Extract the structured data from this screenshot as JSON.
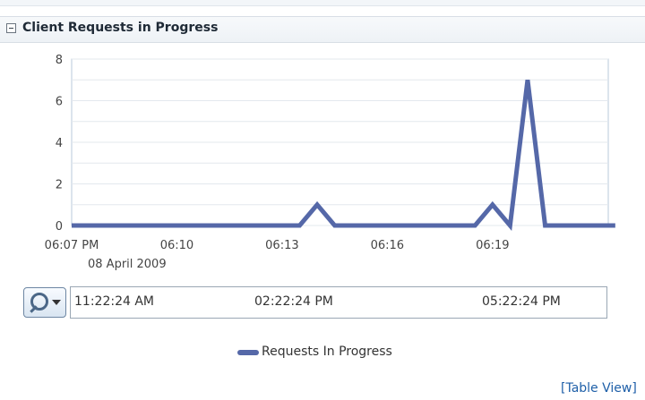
{
  "panel": {
    "title": "Client Requests in Progress"
  },
  "chart_data": {
    "type": "line",
    "title": "",
    "xlabel": "",
    "ylabel": "",
    "ylim": [
      0,
      8
    ],
    "y_ticks": [
      "0",
      "2",
      "4",
      "6",
      "8"
    ],
    "x_tick_labels": [
      "06:07 PM",
      "06:10",
      "06:13",
      "06:16",
      "06:19"
    ],
    "x_sub_label": "08 April 2009",
    "grid": true,
    "series": [
      {
        "name": "Requests In Progress",
        "color": "#5568a8",
        "x": [
          "06:07",
          "06:07.5",
          "06:08",
          "06:08.5",
          "06:09",
          "06:09.5",
          "06:10",
          "06:10.5",
          "06:11",
          "06:11.5",
          "06:12",
          "06:12.5",
          "06:13",
          "06:13.5",
          "06:14",
          "06:14.5",
          "06:15",
          "06:15.5",
          "06:16",
          "06:16.5",
          "06:17",
          "06:17.5",
          "06:18",
          "06:18.5",
          "06:19",
          "06:19.5",
          "06:20",
          "06:20.5",
          "06:21",
          "06:21.5",
          "06:22",
          "06:22.5"
        ],
        "values": [
          0,
          0,
          0,
          0,
          0,
          0,
          0,
          0,
          0,
          0,
          0,
          0,
          0,
          0,
          1,
          0,
          0,
          0,
          0,
          0,
          0,
          0,
          0,
          0,
          1,
          0,
          7,
          0,
          0,
          0,
          0,
          0
        ]
      }
    ]
  },
  "time_selector": {
    "labels": [
      "11:22:24 AM",
      "02:22:24 PM",
      "05:22:24 PM"
    ]
  },
  "legend": {
    "label": "Requests In Progress"
  },
  "links": {
    "table_view": "[Table View]"
  }
}
